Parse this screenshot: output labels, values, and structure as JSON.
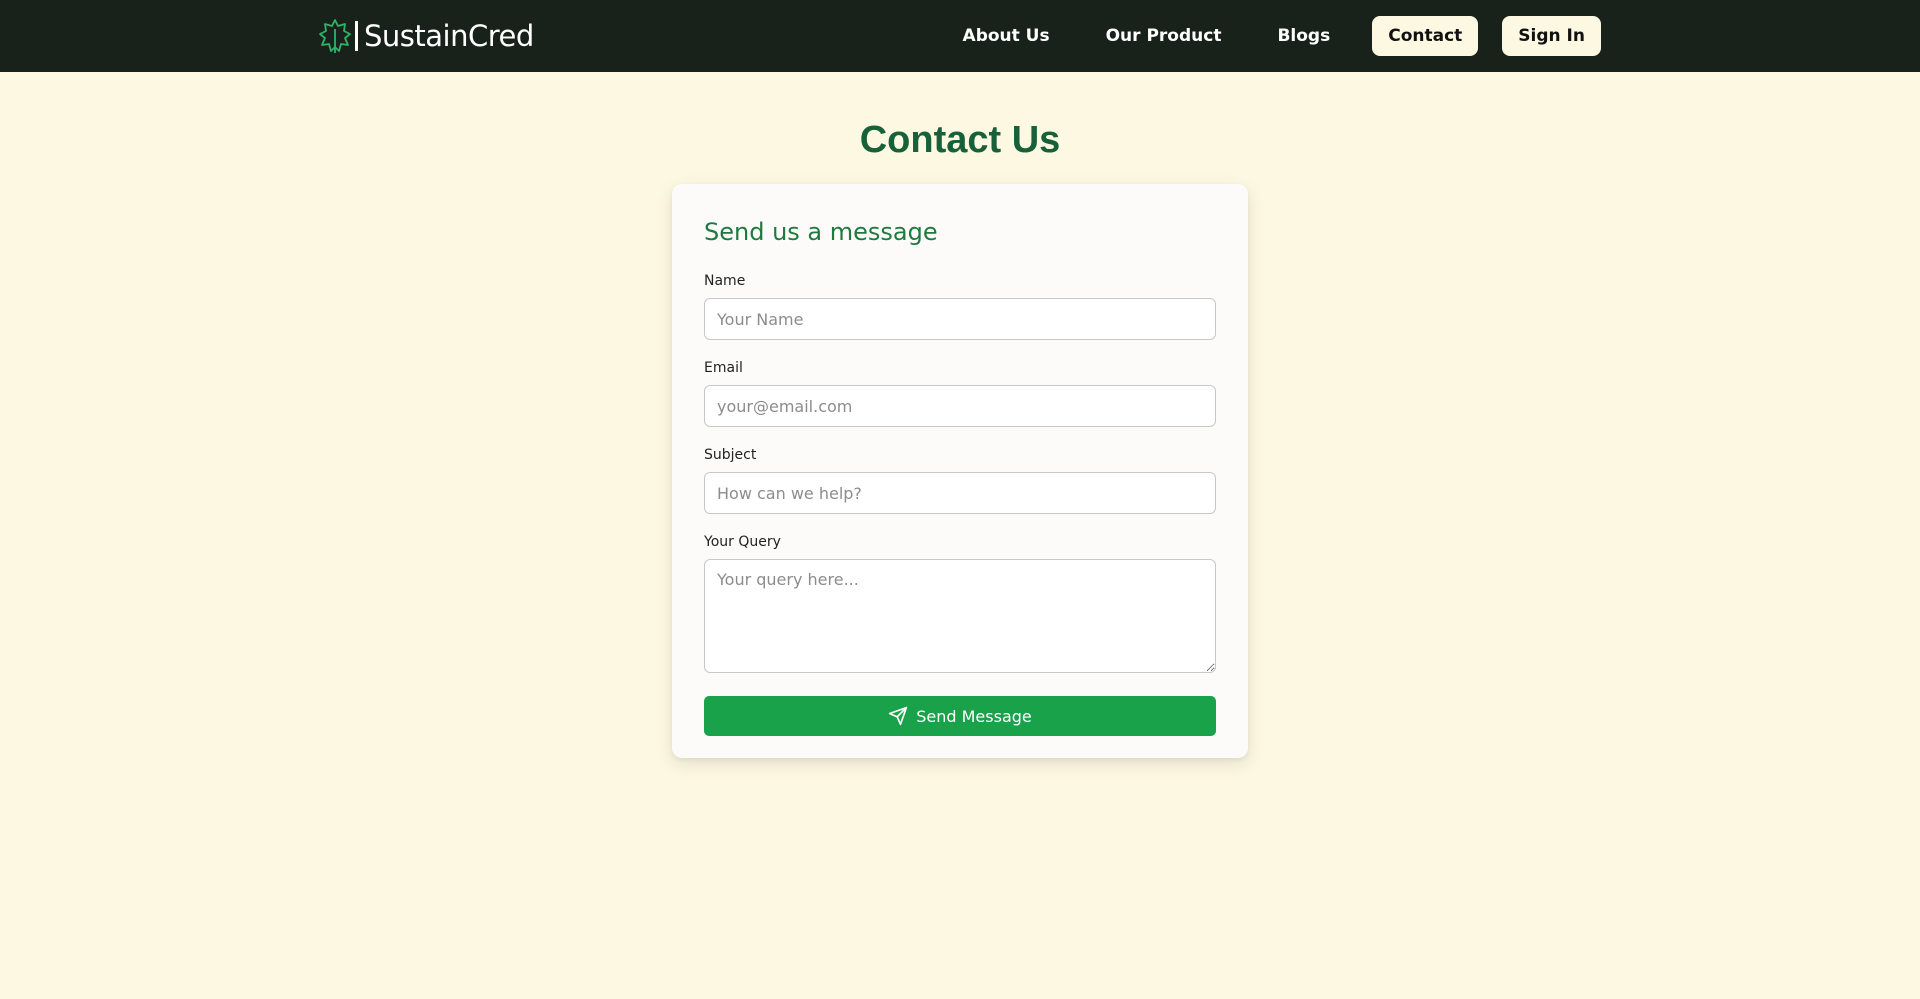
{
  "brand": {
    "name": "SustainCred",
    "logo_icon": "leaf-outline-icon"
  },
  "nav": {
    "links": [
      "About Us",
      "Our Product",
      "Blogs"
    ],
    "contact_label": "Contact",
    "signin_label": "Sign In"
  },
  "page": {
    "title": "Contact Us"
  },
  "form": {
    "heading": "Send us a message",
    "name": {
      "label": "Name",
      "placeholder": "Your Name"
    },
    "email": {
      "label": "Email",
      "placeholder": "your@email.com"
    },
    "subject": {
      "label": "Subject",
      "placeholder": "How can we help?"
    },
    "query": {
      "label": "Your Query",
      "placeholder": "Your query here..."
    },
    "submit_label": "Send Message",
    "submit_icon": "send-icon"
  },
  "colors": {
    "navbar_bg": "#18221b",
    "page_bg": "#fdf8e1",
    "title_green": "#18603a",
    "heading_green": "#1f7a3f",
    "button_green": "#19a24a",
    "logo_accent": "#2fb36a"
  }
}
